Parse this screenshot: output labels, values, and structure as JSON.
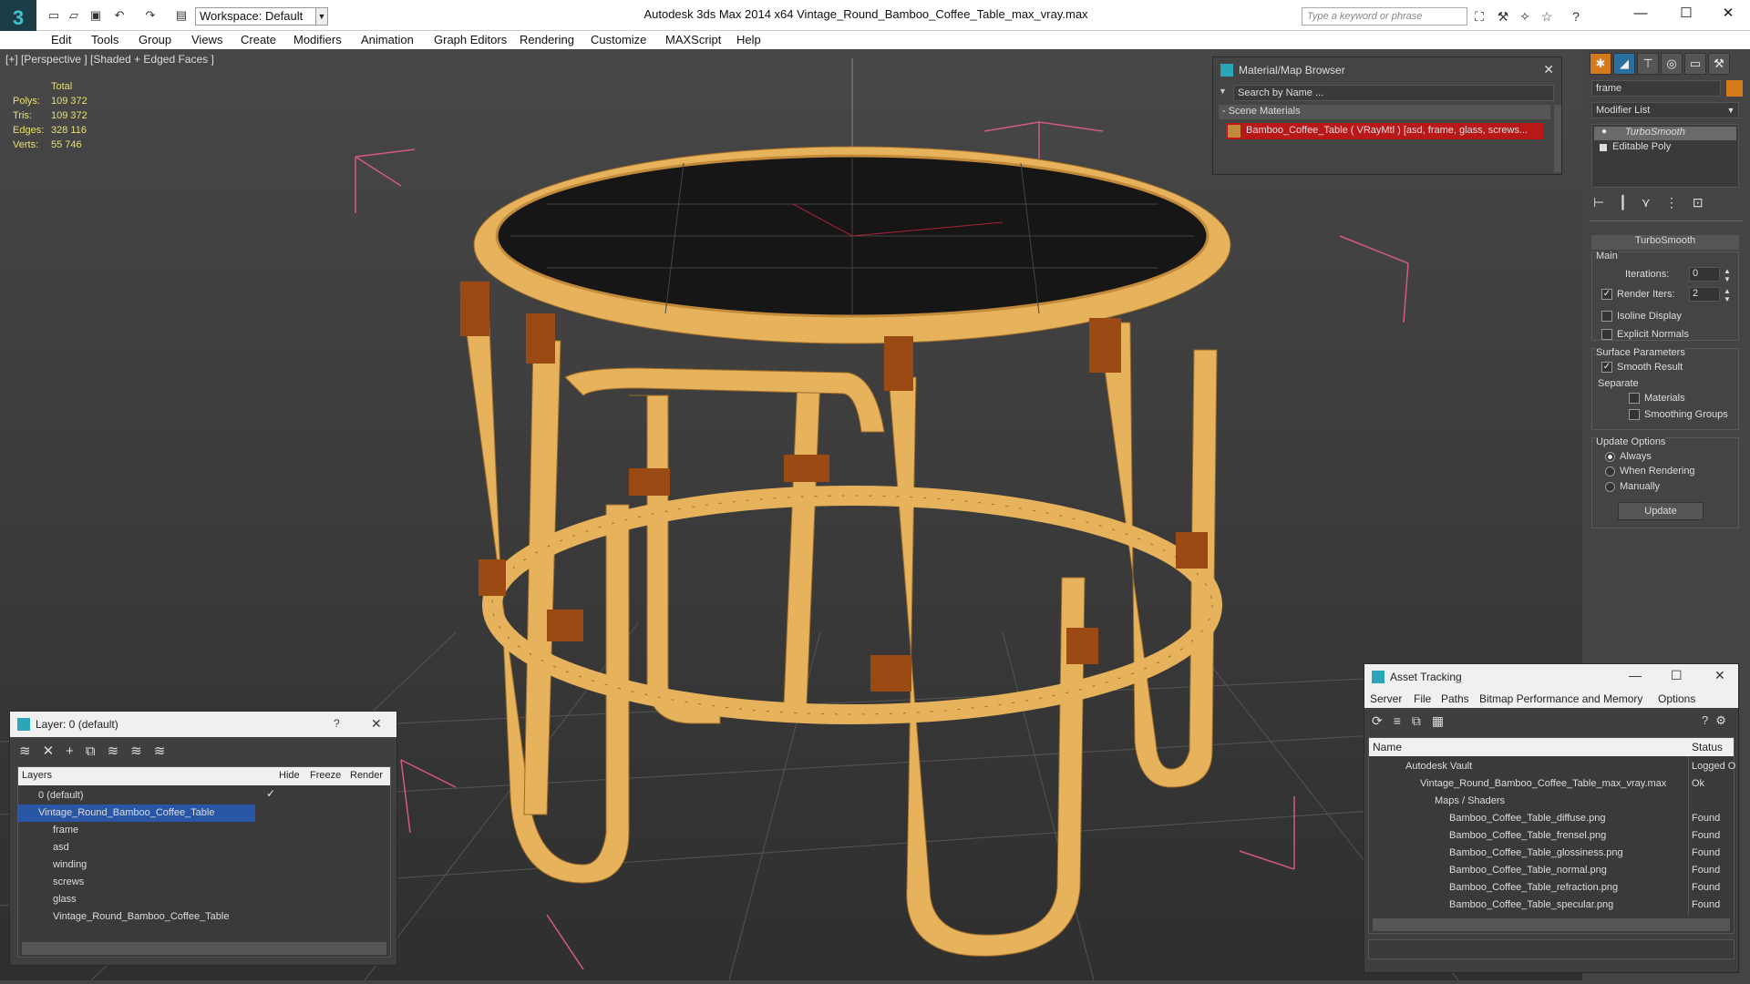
{
  "app": {
    "title": "Autodesk 3ds Max  2014 x64      Vintage_Round_Bamboo_Coffee_Table_max_vray.max",
    "logo": "3"
  },
  "toolbar": {
    "workspace": "Workspace: Default",
    "search_placeholder": "Type a keyword or phrase"
  },
  "menu": [
    "Edit",
    "Tools",
    "Group",
    "Views",
    "Create",
    "Modifiers",
    "Animation",
    "Graph Editors",
    "Rendering",
    "Customize",
    "MAXScript",
    "Help"
  ],
  "viewport": {
    "label": "[+] [Perspective ] [Shaded + Edged Faces ]",
    "stats": {
      "header": "Total",
      "rows": [
        [
          "Polys:",
          "109 372"
        ],
        [
          "Tris:",
          "109 372"
        ],
        [
          "Edges:",
          "328 116"
        ],
        [
          "Verts:",
          "55 746"
        ]
      ]
    },
    "colors": {
      "bamboo": "#e6b35c",
      "binding": "#9b4a14",
      "top": "#161616",
      "bbox": "#d35a86"
    }
  },
  "material_browser": {
    "title": "Material/Map Browser",
    "search": "Search by Name ...",
    "section": "- Scene Materials",
    "item": "Bamboo_Coffee_Table ( VRayMtl ) [asd, frame, glass, screws..."
  },
  "command_panel": {
    "object_name": "frame",
    "modifier_list": "Modifier List",
    "stack": [
      "TurboSmooth",
      "Editable Poly"
    ],
    "rollout": "TurboSmooth",
    "main": "Main",
    "iterations_label": "Iterations:",
    "iterations": "0",
    "render_iters_label": "Render Iters:",
    "render_iters": "2",
    "isoline": "Isoline Display",
    "explicit": "Explicit Normals",
    "surface": "Surface Parameters",
    "smooth_result": "Smooth Result",
    "separate": "Separate",
    "materials": "Materials",
    "smoothing_groups": "Smoothing Groups",
    "update_options": "Update Options",
    "always": "Always",
    "when_rendering": "When Rendering",
    "manually": "Manually",
    "update": "Update"
  },
  "layer_panel": {
    "title": "Layer: 0 (default)",
    "help": "?",
    "columns": [
      "Layers",
      "Hide",
      "Freeze",
      "Render"
    ],
    "rows": [
      {
        "name": "0 (default)",
        "level": 0
      },
      {
        "name": "Vintage_Round_Bamboo_Coffee_Table",
        "level": 0,
        "selected": true
      },
      {
        "name": "frame",
        "level": 1
      },
      {
        "name": "asd",
        "level": 1
      },
      {
        "name": "winding",
        "level": 1
      },
      {
        "name": "screws",
        "level": 1
      },
      {
        "name": "glass",
        "level": 1
      },
      {
        "name": "Vintage_Round_Bamboo_Coffee_Table",
        "level": 1
      }
    ]
  },
  "asset_tracking": {
    "title": "Asset Tracking",
    "menu": [
      "Server",
      "File",
      "Paths",
      "Bitmap Performance and Memory",
      "Options"
    ],
    "columns": [
      "Name",
      "Status"
    ],
    "rows": [
      {
        "name": "Autodesk Vault",
        "status": "Logged O",
        "level": 1
      },
      {
        "name": "Vintage_Round_Bamboo_Coffee_Table_max_vray.max",
        "status": "Ok",
        "level": 2
      },
      {
        "name": "Maps / Shaders",
        "status": "",
        "level": 3
      },
      {
        "name": "Bamboo_Coffee_Table_diffuse.png",
        "status": "Found",
        "level": 4
      },
      {
        "name": "Bamboo_Coffee_Table_frensel.png",
        "status": "Found",
        "level": 4
      },
      {
        "name": "Bamboo_Coffee_Table_glossiness.png",
        "status": "Found",
        "level": 4
      },
      {
        "name": "Bamboo_Coffee_Table_normal.png",
        "status": "Found",
        "level": 4
      },
      {
        "name": "Bamboo_Coffee_Table_refraction.png",
        "status": "Found",
        "level": 4
      },
      {
        "name": "Bamboo_Coffee_Table_specular.png",
        "status": "Found",
        "level": 4
      }
    ]
  }
}
